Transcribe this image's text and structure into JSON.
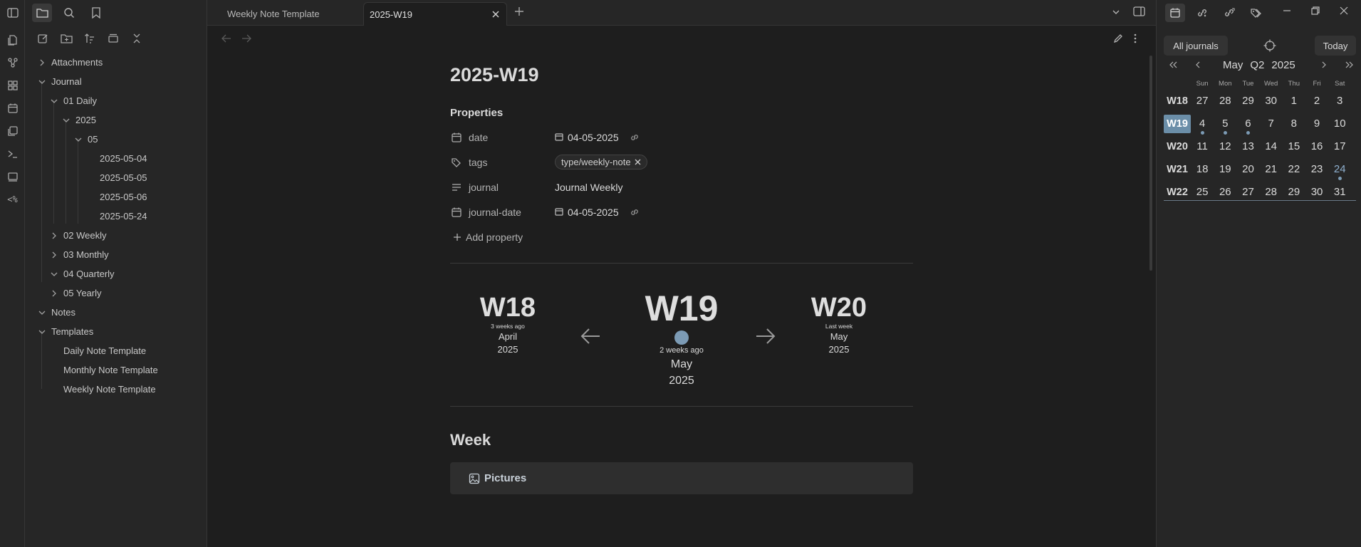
{
  "tabs": {
    "items": [
      {
        "label": "Weekly Note Template"
      },
      {
        "label": "2025-W19"
      }
    ]
  },
  "file_tree": {
    "items": [
      {
        "label": "Attachments"
      },
      {
        "label": "Journal"
      },
      {
        "label": "01 Daily"
      },
      {
        "label": "2025"
      },
      {
        "label": "05"
      },
      {
        "label": "2025-05-04"
      },
      {
        "label": "2025-05-05"
      },
      {
        "label": "2025-05-06"
      },
      {
        "label": "2025-05-24"
      },
      {
        "label": "02 Weekly"
      },
      {
        "label": "03 Monthly"
      },
      {
        "label": "04 Quarterly"
      },
      {
        "label": "05 Yearly"
      },
      {
        "label": "Notes"
      },
      {
        "label": "Templates"
      },
      {
        "label": "Daily Note Template"
      },
      {
        "label": "Monthly Note Template"
      },
      {
        "label": "Weekly Note Template"
      }
    ]
  },
  "note": {
    "title": "2025-W19",
    "properties_heading": "Properties",
    "properties": {
      "date": {
        "key": "date",
        "value": "04-05-2025"
      },
      "tags": {
        "key": "tags",
        "value": "type/weekly-note"
      },
      "journal": {
        "key": "journal",
        "value": "Journal Weekly"
      },
      "journal_date": {
        "key": "journal-date",
        "value": "04-05-2025"
      }
    },
    "add_property": "Add property",
    "week_nav": {
      "prev": {
        "week": "W18",
        "relative": "3 weeks ago",
        "month": "April",
        "year": "2025"
      },
      "current": {
        "week": "W19",
        "relative": "2 weeks ago",
        "month": "May",
        "year": "2025"
      },
      "next": {
        "week": "W20",
        "relative": "Last week",
        "month": "May",
        "year": "2025"
      }
    },
    "week_heading": "Week",
    "callout_title": "Pictures"
  },
  "calendar": {
    "all_journals": "All journals",
    "today": "Today",
    "month": "May",
    "quarter": "Q2",
    "year": "2025",
    "weekdays": [
      "Sun",
      "Mon",
      "Tue",
      "Wed",
      "Thu",
      "Fri",
      "Sat"
    ],
    "weeks": [
      {
        "label": "W18",
        "selected": false,
        "days": [
          "27",
          "28",
          "29",
          "30",
          "1",
          "2",
          "3"
        ],
        "dots": [
          false,
          false,
          false,
          false,
          false,
          false,
          false
        ]
      },
      {
        "label": "W19",
        "selected": true,
        "days": [
          "4",
          "5",
          "6",
          "7",
          "8",
          "9",
          "10"
        ],
        "dots": [
          true,
          true,
          true,
          false,
          false,
          false,
          false
        ]
      },
      {
        "label": "W20",
        "selected": false,
        "days": [
          "11",
          "12",
          "13",
          "14",
          "15",
          "16",
          "17"
        ],
        "dots": [
          false,
          false,
          false,
          false,
          false,
          false,
          false
        ]
      },
      {
        "label": "W21",
        "selected": false,
        "days": [
          "18",
          "19",
          "20",
          "21",
          "22",
          "23",
          "24"
        ],
        "dots": [
          false,
          false,
          false,
          false,
          false,
          false,
          true
        ]
      },
      {
        "label": "W22",
        "selected": false,
        "days": [
          "25",
          "26",
          "27",
          "28",
          "29",
          "30",
          "31"
        ],
        "dots": [
          false,
          false,
          false,
          false,
          false,
          false,
          false
        ]
      }
    ],
    "accent": "#6b8ea8"
  },
  "colors": {
    "background": "#1e1e1e",
    "sidebar": "#262626",
    "dot": "#7c9bb5"
  }
}
